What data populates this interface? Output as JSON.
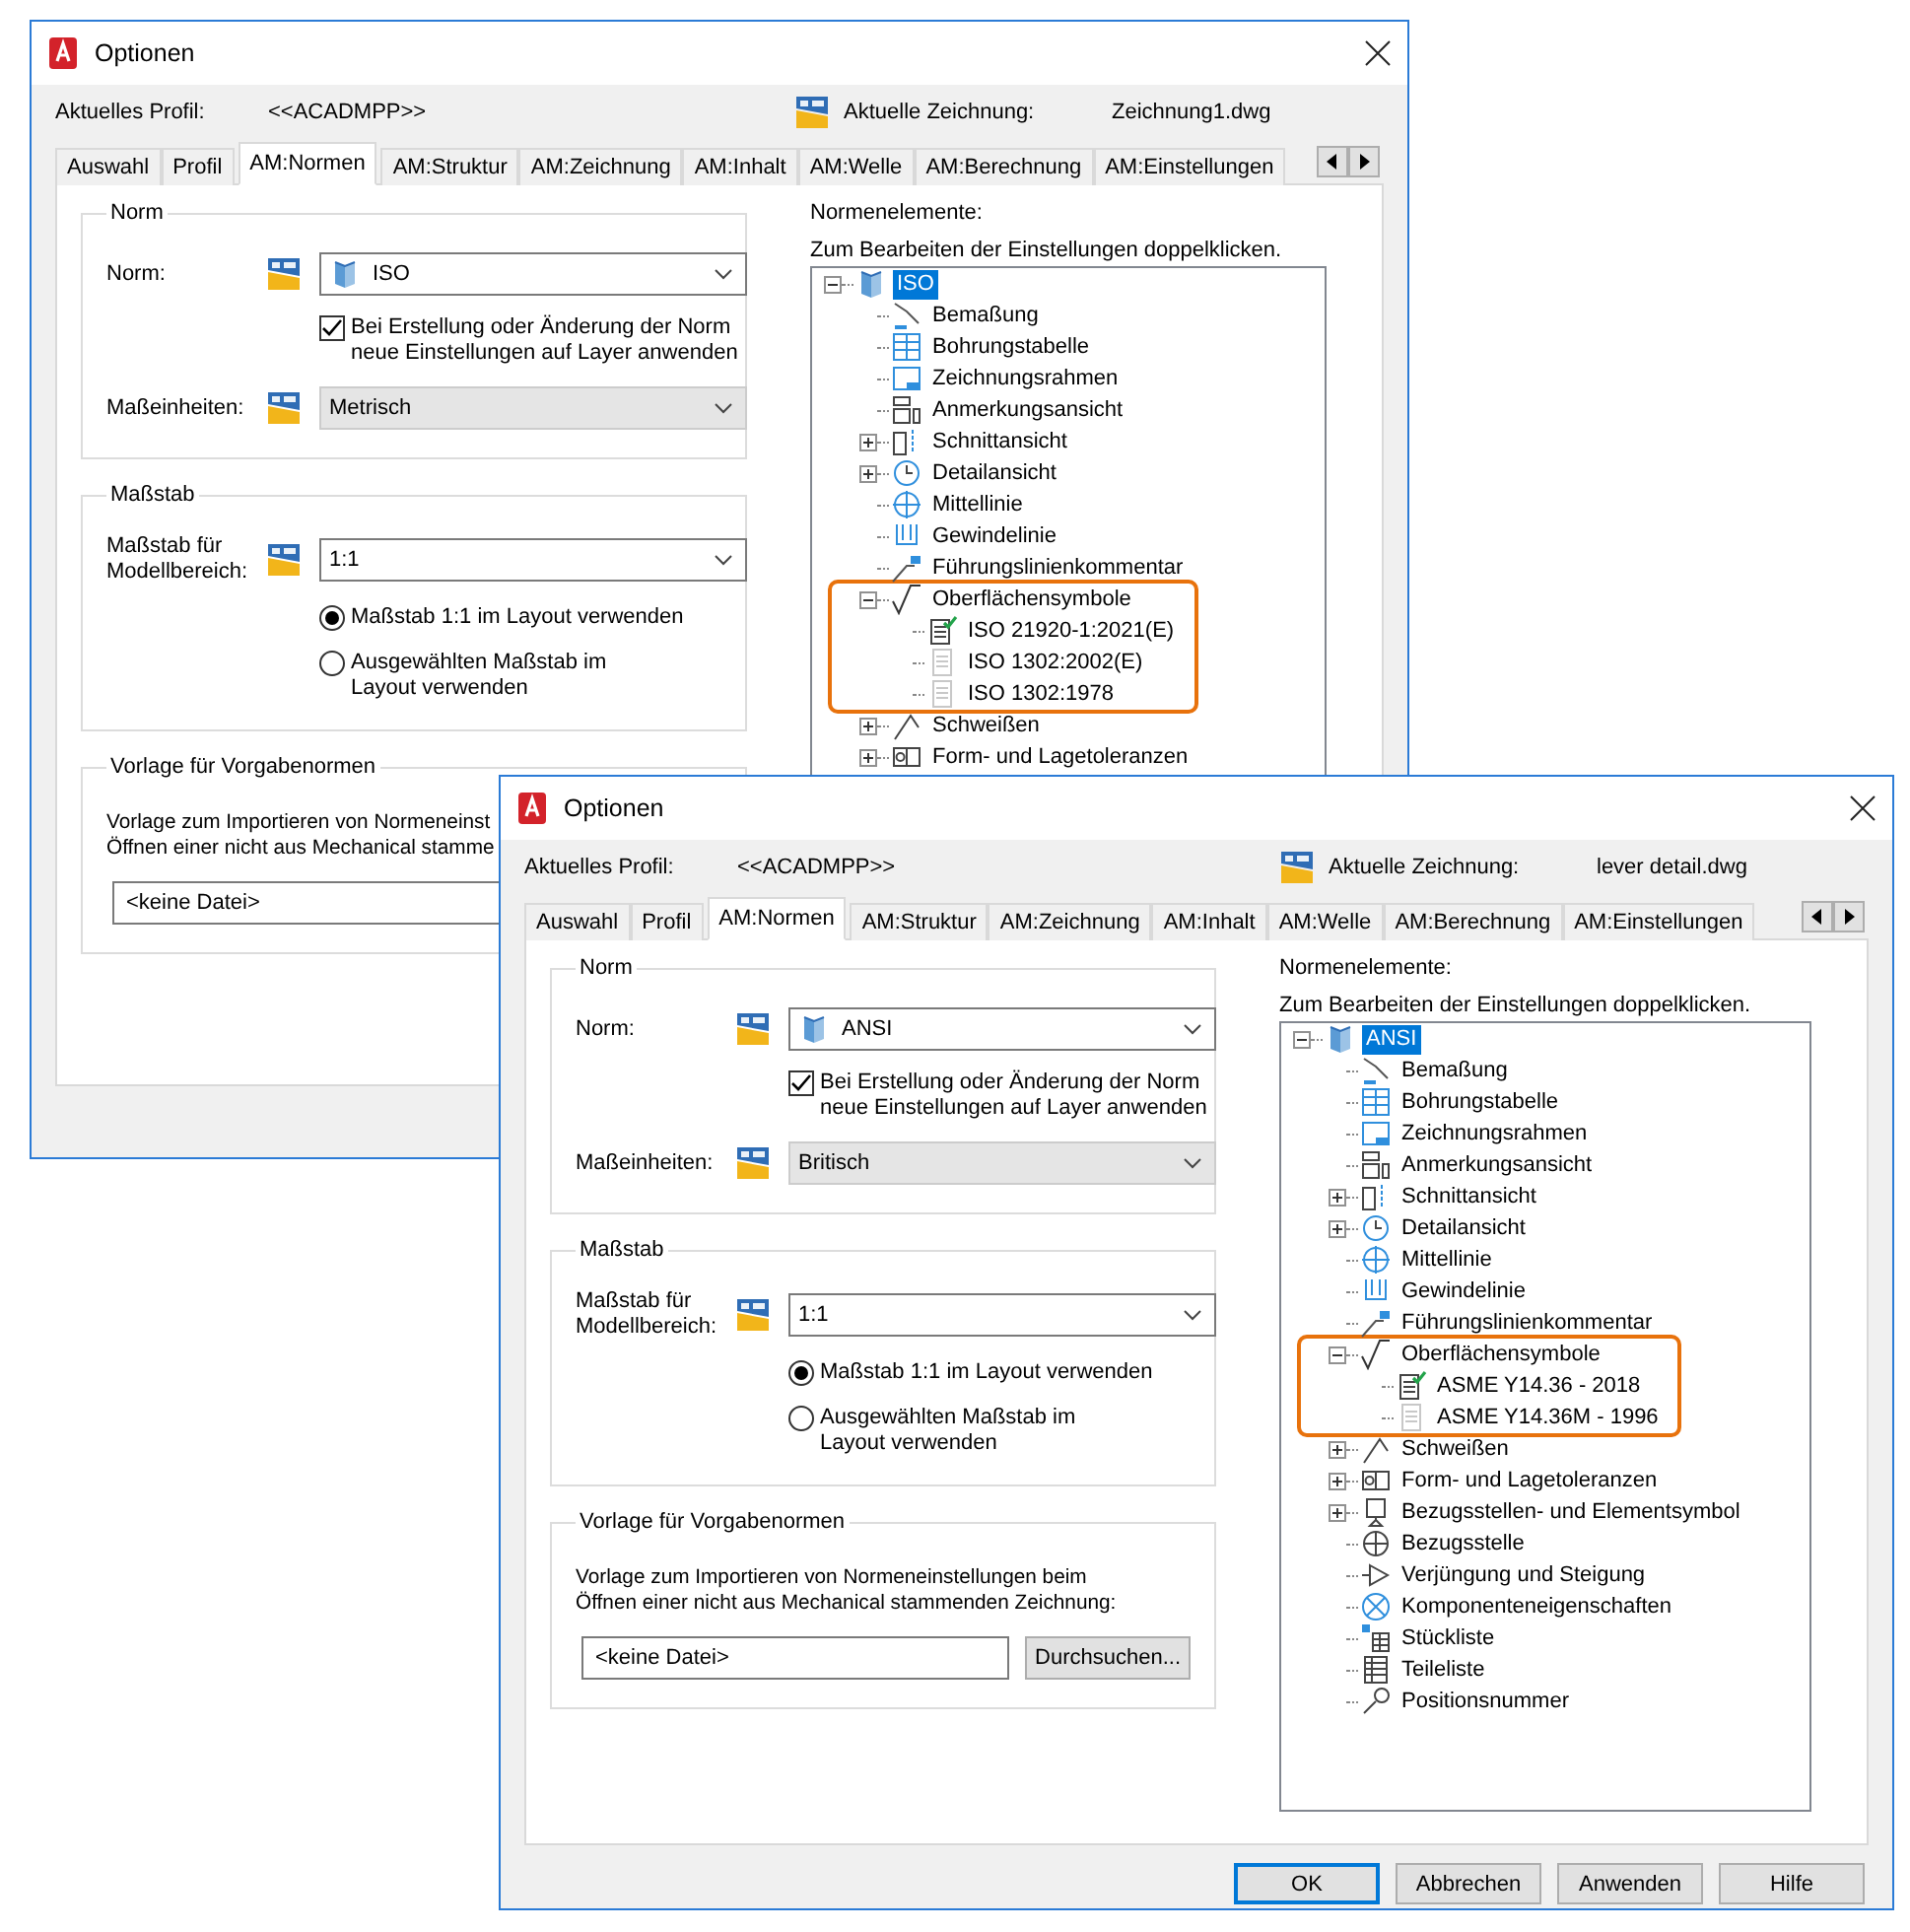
{
  "windows": [
    {
      "title": "Optionen",
      "profile_label": "Aktuelles Profil:",
      "profile": "<<ACADMPP>>",
      "drawing_label": "Aktuelle Zeichnung:",
      "drawing": "Zeichnung1.dwg",
      "tabs": [
        {
          "label": "Auswahl",
          "selected": false
        },
        {
          "label": "Profil",
          "selected": false
        },
        {
          "label": "AM:Normen",
          "selected": true
        },
        {
          "label": "AM:Struktur",
          "selected": false
        },
        {
          "label": "AM:Zeichnung",
          "selected": false
        },
        {
          "label": "AM:Inhalt",
          "selected": false
        },
        {
          "label": "AM:Welle",
          "selected": false
        },
        {
          "label": "AM:Berechnung",
          "selected": false
        },
        {
          "label": "AM:Einstellungen",
          "selected": false
        }
      ],
      "norm_group": {
        "title": "Norm",
        "norm_label": "Norm:",
        "norm_value": "ISO",
        "layer_checkbox": {
          "label": "Bei Erstellung oder Änderung der Norm\nneue Einstellungen auf Layer anwenden",
          "checked": true
        },
        "units_label": "Maßeinheiten:",
        "units_value": "Metrisch",
        "units_disabled": true
      },
      "scale_group": {
        "title": "Maßstab",
        "scale_label": "Maßstab für\nModellbereich:",
        "scale_value": "1:1",
        "options": [
          {
            "label": "Maßstab 1:1 im Layout verwenden",
            "selected": true
          },
          {
            "label": "Ausgewählten Maßstab im\nLayout verwenden",
            "selected": false
          }
        ]
      },
      "template_group": {
        "title": "Vorlage für Vorgabenormen",
        "description": "Vorlage zum Importieren von Normeneinst\nÖffnen einer nicht aus Mechanical stamme",
        "file": "<keine Datei>"
      },
      "elements_label": "Normenelemente:",
      "hint": "Zum Bearbeiten der Einstellungen doppelklicken.",
      "tree": [
        {
          "label": "ISO",
          "selected": true,
          "expanded": true,
          "children": [
            {
              "label": "Bemaßung",
              "selected": false
            },
            {
              "label": "Bohrungstabelle",
              "selected": false
            },
            {
              "label": "Zeichnungsrahmen",
              "selected": false
            },
            {
              "label": "Anmerkungsansicht",
              "selected": false
            },
            {
              "label": "Schnittansicht",
              "selected": false,
              "expanded": false
            },
            {
              "label": "Detailansicht",
              "selected": false,
              "expanded": false
            },
            {
              "label": "Mittellinie",
              "selected": false
            },
            {
              "label": "Gewindelinie",
              "selected": false
            },
            {
              "label": "Führungslinienkommentar",
              "selected": false
            },
            {
              "label": "Oberflächensymbole",
              "selected": false,
              "expanded": true,
              "highlighted": true,
              "children": [
                {
                  "label": "ISO 21920-1:2021(E)",
                  "selected": false,
                  "current": true
                },
                {
                  "label": "ISO 1302:2002(E)",
                  "selected": false,
                  "current": false
                },
                {
                  "label": "ISO 1302:1978",
                  "selected": false,
                  "current": false
                }
              ]
            },
            {
              "label": "Schweißen",
              "selected": false,
              "expanded": false
            },
            {
              "label": "Form- und Lagetoleranzen",
              "selected": false,
              "expanded": false
            }
          ]
        }
      ]
    },
    {
      "title": "Optionen",
      "profile_label": "Aktuelles Profil:",
      "profile": "<<ACADMPP>>",
      "drawing_label": "Aktuelle Zeichnung:",
      "drawing": "lever detail.dwg",
      "tabs": [
        {
          "label": "Auswahl",
          "selected": false
        },
        {
          "label": "Profil",
          "selected": false
        },
        {
          "label": "AM:Normen",
          "selected": true
        },
        {
          "label": "AM:Struktur",
          "selected": false
        },
        {
          "label": "AM:Zeichnung",
          "selected": false
        },
        {
          "label": "AM:Inhalt",
          "selected": false
        },
        {
          "label": "AM:Welle",
          "selected": false
        },
        {
          "label": "AM:Berechnung",
          "selected": false
        },
        {
          "label": "AM:Einstellungen",
          "selected": false
        }
      ],
      "norm_group": {
        "title": "Norm",
        "norm_label": "Norm:",
        "norm_value": "ANSI",
        "layer_checkbox": {
          "label": "Bei Erstellung oder Änderung der Norm\nneue Einstellungen auf Layer anwenden",
          "checked": true
        },
        "units_label": "Maßeinheiten:",
        "units_value": "Britisch",
        "units_disabled": true
      },
      "scale_group": {
        "title": "Maßstab",
        "scale_label": "Maßstab für\nModellbereich:",
        "scale_value": "1:1",
        "options": [
          {
            "label": "Maßstab 1:1 im Layout verwenden",
            "selected": true
          },
          {
            "label": "Ausgewählten Maßstab im\nLayout verwenden",
            "selected": false
          }
        ]
      },
      "template_group": {
        "title": "Vorlage für Vorgabenormen",
        "description": "Vorlage zum Importieren von Normeneinstellungen beim\nÖffnen einer nicht aus Mechanical stammenden Zeichnung:",
        "file": "<keine Datei>",
        "browse": "Durchsuchen..."
      },
      "elements_label": "Normenelemente:",
      "hint": "Zum Bearbeiten der Einstellungen doppelklicken.",
      "tree": [
        {
          "label": "ANSI",
          "selected": true,
          "expanded": true,
          "children": [
            {
              "label": "Bemaßung",
              "selected": false
            },
            {
              "label": "Bohrungstabelle",
              "selected": false
            },
            {
              "label": "Zeichnungsrahmen",
              "selected": false
            },
            {
              "label": "Anmerkungsansicht",
              "selected": false
            },
            {
              "label": "Schnittansicht",
              "selected": false,
              "expanded": false
            },
            {
              "label": "Detailansicht",
              "selected": false,
              "expanded": false
            },
            {
              "label": "Mittellinie",
              "selected": false
            },
            {
              "label": "Gewindelinie",
              "selected": false
            },
            {
              "label": "Führungslinienkommentar",
              "selected": false
            },
            {
              "label": "Oberflächensymbole",
              "selected": false,
              "expanded": true,
              "highlighted": true,
              "children": [
                {
                  "label": "ASME Y14.36 - 2018",
                  "selected": false,
                  "current": true
                },
                {
                  "label": "ASME Y14.36M - 1996",
                  "selected": false,
                  "current": false
                }
              ]
            },
            {
              "label": "Schweißen",
              "selected": false,
              "expanded": false
            },
            {
              "label": "Form- und Lagetoleranzen",
              "selected": false,
              "expanded": false
            },
            {
              "label": "Bezugsstellen- und Elementsymbol",
              "selected": false,
              "expanded": false
            },
            {
              "label": "Bezugsstelle",
              "selected": false
            },
            {
              "label": "Verjüngung und Steigung",
              "selected": false
            },
            {
              "label": "Komponenteneigenschaften",
              "selected": false
            },
            {
              "label": "Stückliste",
              "selected": false
            },
            {
              "label": "Teileliste",
              "selected": false
            },
            {
              "label": "Positionsnummer",
              "selected": false
            }
          ]
        }
      ],
      "buttons": [
        {
          "label": "OK",
          "default": true
        },
        {
          "label": "Abbrechen",
          "default": false
        },
        {
          "label": "Anwenden",
          "default": false
        },
        {
          "label": "Hilfe",
          "default": false
        }
      ]
    }
  ]
}
